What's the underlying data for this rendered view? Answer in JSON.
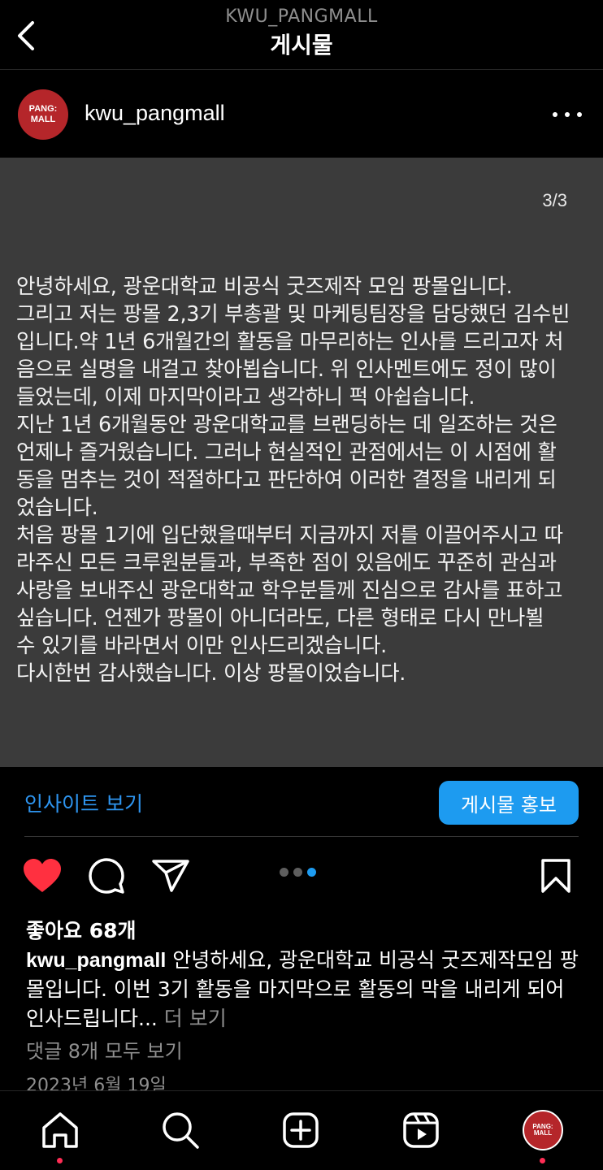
{
  "header": {
    "account": "KWU_PANGMALL",
    "title": "게시물",
    "back_icon": "chevron-left-icon"
  },
  "post": {
    "avatar_line1": "PANG:",
    "avatar_line2": "MALL",
    "username": "kwu_pangmall",
    "slide_counter": "3/3",
    "slide_text": "안녕하세요, 광운대학교 비공식 굿즈제작 모임 팡몰입니다.\n그리고 저는 팡몰 2,3기 부총괄 및 마케팅팀장을 담당했던 김수빈\n입니다.약 1년 6개월간의 활동을 마무리하는 인사를 드리고자 처\n음으로 실명을 내걸고 찾아뵙습니다. 위 인사멘트에도 정이 많이\n들었는데, 이제 마지막이라고 생각하니 퍽 아쉽습니다.\n지난 1년 6개월동안 광운대학교를  브랜딩하는 데 일조하는 것은\n언제나 즐거웠습니다. 그러나 현실적인 관점에서는 이 시점에 활\n동을 멈추는 것이 적절하다고 판단하여 이러한 결정을 내리게 되\n었습니다.\n처음 팡몰 1기에 입단했을때부터 지금까지 저를 이끌어주시고 따\n라주신 모든 크루원분들과, 부족한 점이 있음에도 꾸준히 관심과\n사랑을 보내주신 광운대학교 학우분들께 진심으로 감사를 표하고\n싶습니다. 언젠가 팡몰이 아니더라도, 다른 형태로 다시 만나뵐\n수 있기를 바라면서 이만 인사드리겠습니다.\n다시한번 감사했습니다. 이상 팡몰이었습니다.",
    "insight_label": "인사이트 보기",
    "promote_label": "게시물 홍보",
    "likes_text": "좋아요 68개",
    "caption_user": "kwu_pangmall",
    "caption_text": " 안녕하세요, 광운대학교 비공식 굿즈제작모임 팡몰입니다. 이번 3기 활동을 마지막으로 활동의 막을 내리게 되어 인사드립니다... ",
    "caption_more": "더 보기",
    "comments_link": "댓글 8개 모두 보기",
    "date": "2023년 6월 19일",
    "carousel": {
      "total": 3,
      "active_index": 2
    },
    "liked": true
  },
  "icons": {
    "like": "heart-icon",
    "comment": "comment-icon",
    "share": "send-icon",
    "save": "bookmark-icon"
  },
  "bottom_nav": [
    "home-icon",
    "search-icon",
    "create-icon",
    "reels-icon",
    "profile-avatar"
  ],
  "colors": {
    "accent_blue": "#1d9bf0",
    "like_red": "#ff3040",
    "slide_bg": "#3b3b3b",
    "brand_red": "#b5262a"
  }
}
